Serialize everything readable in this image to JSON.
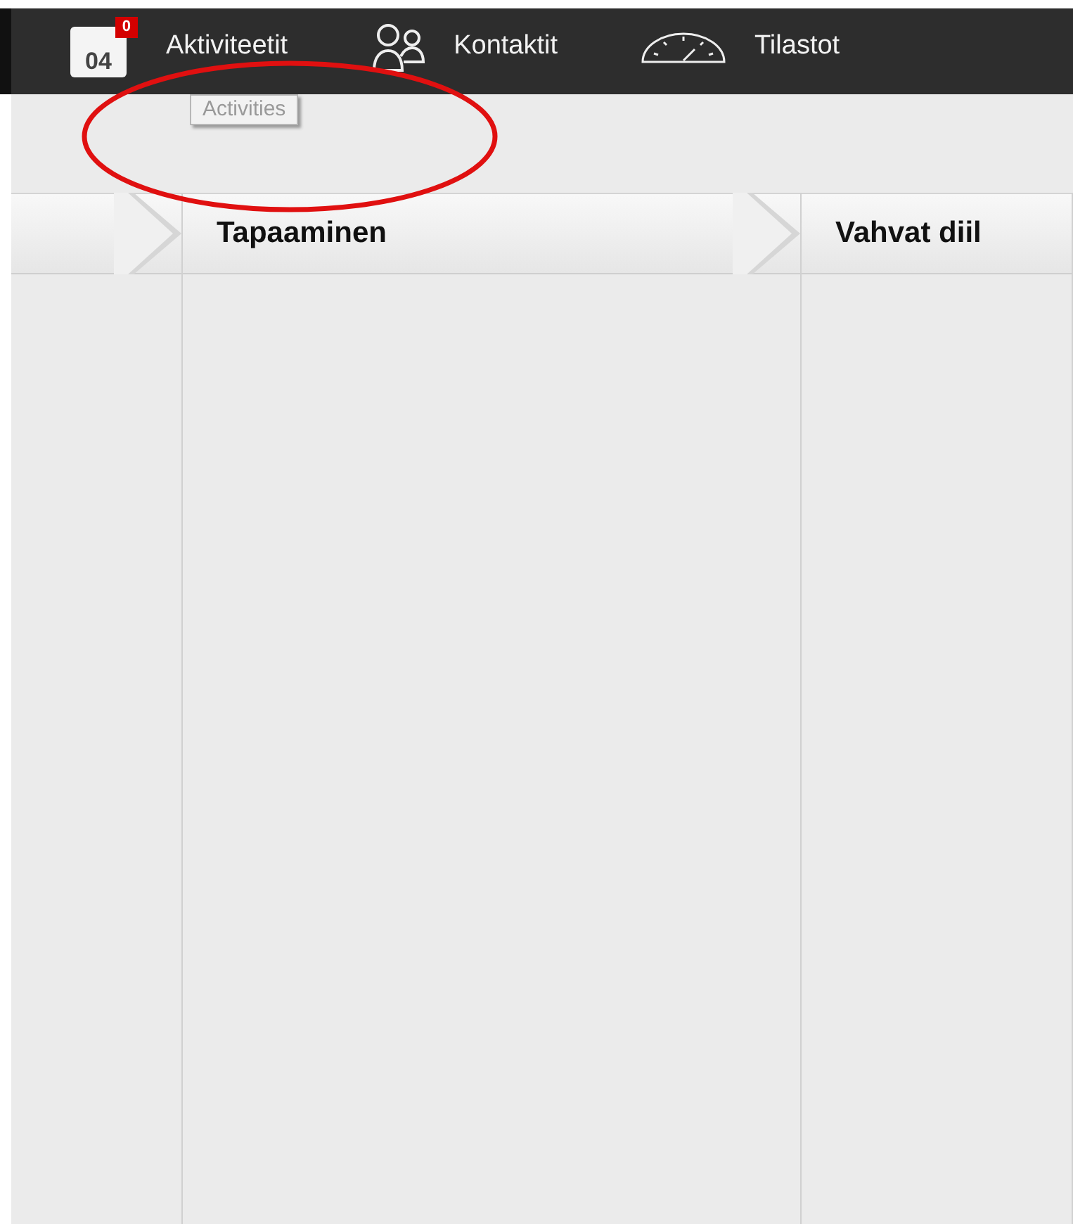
{
  "nav": [
    {
      "kind": "calendar",
      "label": "Aktiviteetit",
      "day": "04",
      "badge": "0",
      "tooltip": "Activities"
    },
    {
      "kind": "people",
      "label": "Kontaktit"
    },
    {
      "kind": "gauge",
      "label": "Tilastot"
    }
  ],
  "columns": [
    {},
    {
      "title": "Tapaaminen"
    },
    {
      "title": "Vahvat diil"
    }
  ],
  "annotation": {
    "kind": "ellipse"
  }
}
